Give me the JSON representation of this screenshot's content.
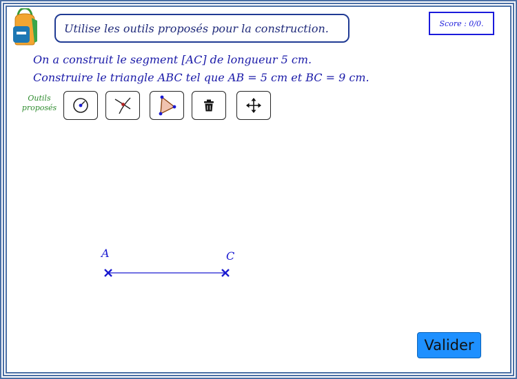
{
  "instruction": "Utilise les outils proposés pour la construction.",
  "score": "Score : 0/0.",
  "statement": {
    "line1": "On a construit le segment [AC] de longueur 5 cm.",
    "line2": "Construire le triangle ABC tel que AB = 5 cm et BC = 9 cm."
  },
  "tools": {
    "label_line1": "Outils",
    "label_line2": "proposés",
    "items": [
      {
        "icon": "compass-circle-icon"
      },
      {
        "icon": "intersection-icon"
      },
      {
        "icon": "polygon-icon"
      },
      {
        "icon": "trash-icon"
      },
      {
        "icon": "move-icon"
      }
    ]
  },
  "points": {
    "a_label": "A",
    "c_label": "C"
  },
  "validate_label": "Valider",
  "colors": {
    "frame": "#4a6fa5",
    "text": "#1a1aa8",
    "tools_label": "#2e8b2e",
    "button": "#1e90ff",
    "segment": "#1a1ad0"
  }
}
